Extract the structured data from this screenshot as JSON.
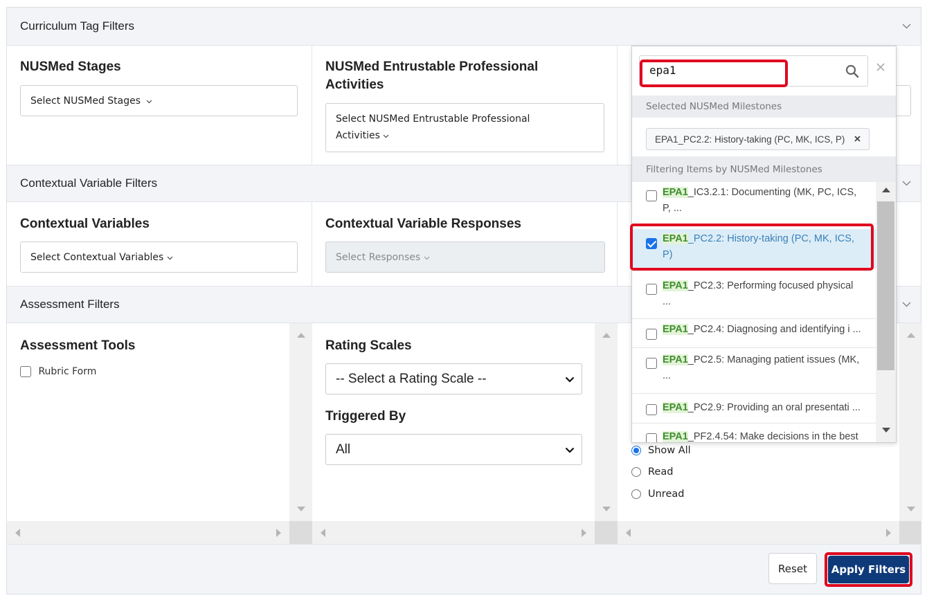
{
  "sections": {
    "curriculum": "Curriculum Tag Filters",
    "contextual": "Contextual Variable Filters",
    "assessment": "Assessment Filters"
  },
  "curriculum": {
    "stages": {
      "title": "NUSMed Stages",
      "placeholder": "Select NUSMed Stages"
    },
    "epa": {
      "title_line1": "NUSMed Entrustable Professional",
      "title_line2": "Activities",
      "placeholder_line1": "Select NUSMed Entrustable Professional",
      "placeholder_line2": "Activities"
    }
  },
  "contextual": {
    "variables": {
      "title": "Contextual Variables",
      "placeholder": "Select Contextual Variables"
    },
    "responses": {
      "title": "Contextual Variable Responses",
      "placeholder": "Select Responses"
    }
  },
  "assessment": {
    "tools": {
      "title": "Assessment Tools",
      "option": "Rubric Form"
    },
    "rating": {
      "title": "Rating Scales",
      "selected": "-- Select a Rating Scale --"
    },
    "triggered": {
      "title": "Triggered By",
      "selected": "All"
    },
    "read_status": [
      "Show All",
      "Read",
      "Unread"
    ]
  },
  "dropdown": {
    "search_value": "epa1",
    "selected_label": "Selected NUSMed Milestones",
    "selected_chip": "EPA1_PC2.2: History-taking (PC, MK, ICS, P)",
    "filtering_label": "Filtering Items by NUSMed Milestones",
    "match": "EPA1",
    "items": [
      {
        "rest_line1": "_IC3.2.1: Documenting (MK, PC, ICS,",
        "rest_line2": "P, ...",
        "checked": false
      },
      {
        "rest_line1": "_PC2.2: History-taking (PC, MK, ICS,",
        "rest_line2": "P)",
        "checked": true
      },
      {
        "rest_line1": "_PC2.3: Performing focused physical",
        "rest_line2": "...",
        "checked": false
      },
      {
        "rest_line1": "_PC2.4: Diagnosing and identifying i ...",
        "rest_line2": "",
        "checked": false
      },
      {
        "rest_line1": "_PC2.5: Managing patient issues (MK,",
        "rest_line2": "...",
        "checked": false
      },
      {
        "rest_line1": "_PC2.9: Providing an oral presentati ...",
        "rest_line2": "",
        "checked": false
      },
      {
        "rest_line1": "_PF2.4.54: Make decisions in the best",
        "rest_line2": "",
        "checked": false
      }
    ]
  },
  "buttons": {
    "reset": "Reset",
    "apply": "Apply Filters"
  },
  "colors": {
    "highlight": "#e0061f",
    "primary": "#0f3a7a",
    "checkbox": "#1a73e8"
  }
}
